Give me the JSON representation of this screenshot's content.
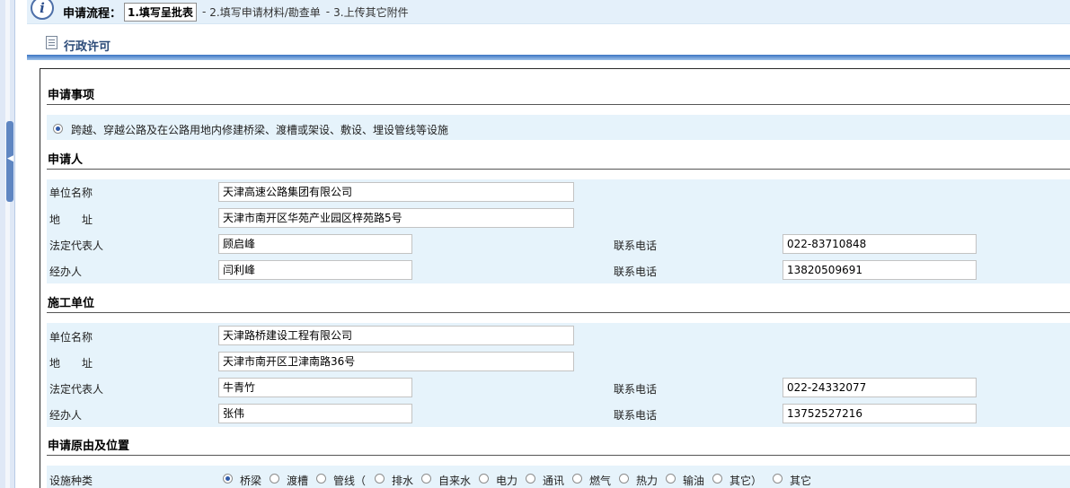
{
  "stepbar": {
    "title": "申请流程：",
    "step1": "1.填写呈批表",
    "sep": "-",
    "step2": "2.填写申请材料/勘查单",
    "step3": "3.上传其它附件"
  },
  "page": {
    "title": "行政许可"
  },
  "application_item": {
    "heading": "申请事项",
    "option": "跨越、穿越公路及在公路用地内修建桥梁、渡槽或架设、敷设、埋设管线等设施",
    "selected": true
  },
  "applicant": {
    "heading": "申请人",
    "unit_label": "单位名称",
    "unit_value": "天津高速公路集团有限公司",
    "address_label": "地　　址",
    "address_value": "天津市南开区华苑产业园区梓苑路5号",
    "rep_label": "法定代表人",
    "rep_value": "顾启峰",
    "rep_phone_label": "联系电话",
    "rep_phone_value": "022-83710848",
    "agent_label": "经办人",
    "agent_value": "闫利峰",
    "agent_phone_label": "联系电话",
    "agent_phone_value": "13820509691"
  },
  "contractor": {
    "heading": "施工单位",
    "unit_label": "单位名称",
    "unit_value": "天津路桥建设工程有限公司",
    "address_label": "地　　址",
    "address_value": "天津市南开区卫津南路36号",
    "rep_label": "法定代表人",
    "rep_value": "牛青竹",
    "rep_phone_label": "联系电话",
    "rep_phone_value": "022-24332077",
    "agent_label": "经办人",
    "agent_value": "张伟",
    "agent_phone_label": "联系电话",
    "agent_phone_value": "13752527216"
  },
  "reason": {
    "heading": "申请原由及位置",
    "facility_label": "设施种类",
    "facility_options": [
      "桥梁",
      "渡槽",
      "管线（",
      "排水",
      "自来水",
      "电力",
      "通讯",
      "燃气",
      "热力",
      "输油",
      "其它）",
      "其它"
    ],
    "facility_selected": "桥梁"
  }
}
